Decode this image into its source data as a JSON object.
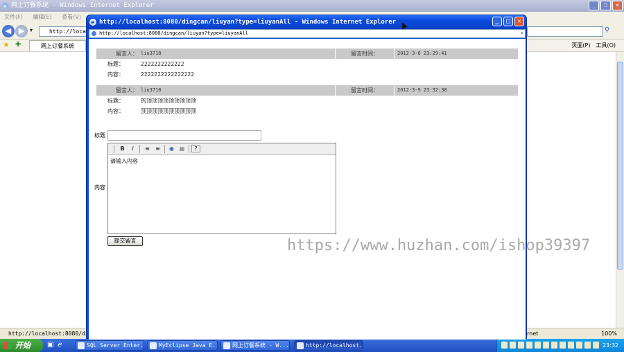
{
  "background_window": {
    "title": "网上订餐系统 - Windows Internet Explorer",
    "menu": [
      "文件(F)",
      "编辑(E)",
      "查看(V)"
    ],
    "address": "http://localh",
    "tab_label": "网上订餐系统",
    "toolbar_right": [
      "页面(P)",
      "工具(O)"
    ],
    "status_url": "http://localhost:8080/dingc",
    "status_zone": "rnet",
    "zoom": "100%"
  },
  "popup": {
    "title": "http://localhost:8080/dingcan/liuyan?type=liuyanAll - Windows Internet Explorer",
    "address": "http://localhost:8080/dingcan/liuyan?type=liuyanAll",
    "messages": [
      {
        "author_label": "留言人：",
        "author": "liu3718",
        "time_label": "留言时间：",
        "time": "2012-3-6 23:29:41",
        "subject_label": "标题：",
        "subject": "2222222222222",
        "content_label": "内容：",
        "content": "2222222222222222"
      },
      {
        "author_label": "留言人：",
        "author": "liu3718",
        "time_label": "留言时间：",
        "time": "2012-3-9 23:32:38",
        "subject_label": "标题：",
        "subject": "的顶顶顶顶顶顶顶顶顶",
        "content_label": "内容：",
        "content": "顶顶顶顶顶顶顶顶顶顶"
      }
    ],
    "form": {
      "title_label": "标题",
      "title_value": "",
      "content_label": "内容",
      "editor_placeholder": "请输入内容",
      "toolbar": [
        "B",
        "I",
        "≡",
        "≡",
        "◉",
        "▦",
        "?"
      ],
      "submit_label": "提交留言"
    }
  },
  "watermark": "https://www.huzhan.com/ishop39397",
  "taskbar": {
    "start_label": "开始",
    "items": [
      "SQL Server Enter...",
      "MyEclipse Java E...",
      "网上订餐系统 - W...",
      "http://localhost..."
    ],
    "clock": "23:32"
  },
  "colors": {
    "popup_frame": "#0a4bdc",
    "message_header": "#c9c9c9",
    "taskbar": "#2c5fd0",
    "start_button": "#3c9c3a"
  }
}
